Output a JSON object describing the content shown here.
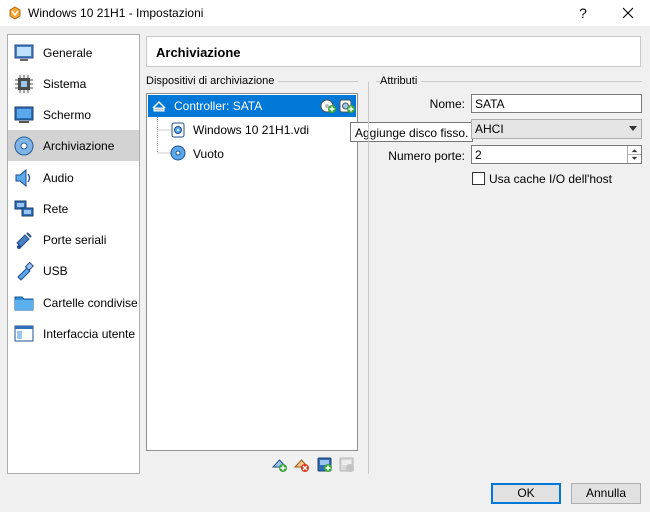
{
  "window": {
    "title": "Windows 10 21H1 - Impostazioni",
    "help": "?"
  },
  "sidebar": {
    "items": [
      {
        "label": "Generale",
        "icon": "general-icon"
      },
      {
        "label": "Sistema",
        "icon": "system-icon"
      },
      {
        "label": "Schermo",
        "icon": "display-icon"
      },
      {
        "label": "Archiviazione",
        "icon": "storage-icon",
        "active": true
      },
      {
        "label": "Audio",
        "icon": "audio-icon"
      },
      {
        "label": "Rete",
        "icon": "network-icon"
      },
      {
        "label": "Porte seriali",
        "icon": "serial-ports-icon"
      },
      {
        "label": "USB",
        "icon": "usb-icon"
      },
      {
        "label": "Cartelle condivise",
        "icon": "shared-folders-icon"
      },
      {
        "label": "Interfaccia utente",
        "icon": "user-interface-icon"
      }
    ]
  },
  "page": {
    "title": "Archiviazione"
  },
  "devices": {
    "group_label": "Dispositivi di archiviazione",
    "controller": "Controller: SATA",
    "disk": "Windows 10 21H1.vdi",
    "optical": "Vuoto",
    "tooltip": "Aggiunge disco fisso."
  },
  "attributes": {
    "group_label": "Attributi",
    "name_label": "Nome:",
    "name_value": "SATA",
    "type_value": "AHCI",
    "ports_label": "Numero porte:",
    "ports_value": "2",
    "cache_label": "Usa cache I/O dell'host",
    "cache_checked": false
  },
  "buttons": {
    "ok": "OK",
    "cancel": "Annulla"
  },
  "colors": {
    "selection": "#0078d7",
    "accent_green": "#3aa53a",
    "accent_red": "#d9381e"
  }
}
